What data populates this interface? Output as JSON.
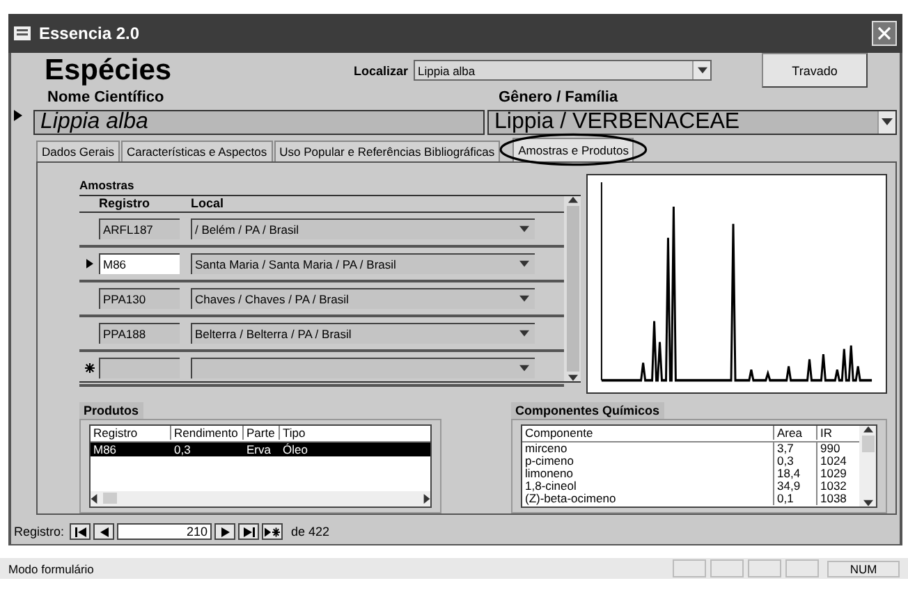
{
  "window": {
    "title": "Essencia 2.0"
  },
  "header": {
    "title": "Espécies",
    "search_label": "Localizar",
    "search_value": "Lippia alba",
    "lock_button": "Travado"
  },
  "fields": [
    {
      "label": "Nome Científico",
      "value": "Lippia alba",
      "kind": "text"
    },
    {
      "label": "Gênero / Família",
      "value": "Lippia / VERBENACEAE",
      "kind": "combo"
    }
  ],
  "tabs": [
    {
      "label": "Dados Gerais",
      "selected": false
    },
    {
      "label": "Características e Aspectos",
      "selected": false
    },
    {
      "label": "Uso Popular e Referências Bibliográficas",
      "selected": false
    },
    {
      "label": "Amostras e Produtos",
      "selected": true
    }
  ],
  "samples": {
    "title": "Amostras",
    "columns": [
      "Registro",
      "Local"
    ],
    "rows": [
      {
        "kind": "normal",
        "registro": "ARFL187",
        "local": "/ Belém / PA / Brasil"
      },
      {
        "kind": "current",
        "registro": "M86",
        "local": "Santa Maria / Santa Maria / PA / Brasil"
      },
      {
        "kind": "normal",
        "registro": "PPA130",
        "local": "Chaves / Chaves / PA / Brasil"
      },
      {
        "kind": "normal",
        "registro": "PPA188",
        "local": "Belterra / Belterra / PA / Brasil"
      },
      {
        "kind": "new",
        "registro": "",
        "local": ""
      }
    ]
  },
  "products": {
    "title": "Produtos",
    "columns": [
      "Registro",
      "Rendimento",
      "Parte",
      "Tipo"
    ],
    "rows": [
      {
        "cells": [
          "M86",
          "0,3",
          "Erva",
          "Óleo"
        ],
        "selected": true
      }
    ]
  },
  "components": {
    "title": "Componentes Químicos",
    "columns": [
      "Componente",
      "Area",
      "IR"
    ],
    "rows": [
      [
        "mirceno",
        "3,7",
        "990"
      ],
      [
        "p-cimeno",
        "0,3",
        "1024"
      ],
      [
        "limoneno",
        "18,4",
        "1029"
      ],
      [
        "1,8-cineol",
        "34,9",
        "1032"
      ],
      [
        "(Z)-beta-ocimeno",
        "0,1",
        "1038"
      ]
    ]
  },
  "navigator": {
    "label": "Registro:",
    "value": "210",
    "total": "de 422"
  },
  "status_bar": {
    "mode": "Modo formulário",
    "indicator": "NUM"
  }
}
